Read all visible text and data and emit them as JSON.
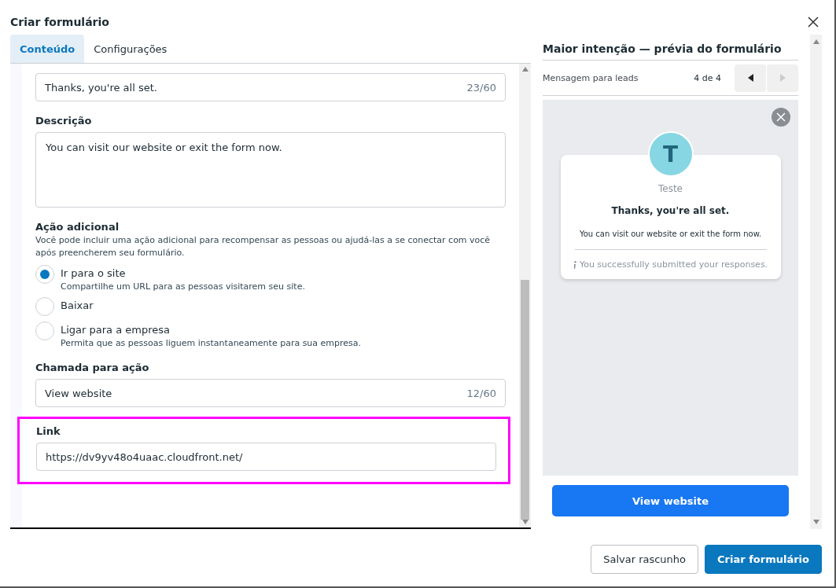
{
  "window": {
    "title": "Criar formulário"
  },
  "tabs": [
    {
      "label": "Conteúdo",
      "selected": true
    },
    {
      "label": "Configurações",
      "selected": false
    }
  ],
  "form": {
    "title_field": {
      "value": "Thanks, you're all set.",
      "counter": "23/60"
    },
    "description": {
      "label": "Descrição",
      "value": "You can visit our website or exit the form now."
    },
    "additional_action": {
      "label": "Ação adicional",
      "help": "Você pode incluir uma ação adicional para recompensar as pessoas ou ajudá-las a se conectar com você após preencherem seu formulário.",
      "options": [
        {
          "label": "Ir para o site",
          "hint": "Compartilhe um URL para as pessoas visitarem seu site.",
          "selected": true
        },
        {
          "label": "Baixar",
          "selected": false
        },
        {
          "label": "Ligar para a empresa",
          "hint": "Permita que as pessoas liguem instantaneamente para sua empresa.",
          "selected": false
        }
      ]
    },
    "cta": {
      "label": "Chamada para ação",
      "value": "View website",
      "counter": "12/60"
    },
    "link": {
      "label": "Link",
      "value": "https://dv9yv48o4uaac.cloudfront.net/",
      "highlighted": true
    }
  },
  "preview": {
    "title": "Maior intenção — prévia do formulário",
    "section": "Mensagem para leads",
    "pager": "4 de 4",
    "card": {
      "avatar": "T",
      "name": "Teste",
      "heading": "Thanks, you're all set.",
      "body": "You can visit our website or exit the form now.",
      "note": "You successfully submitted your responses."
    },
    "button": "View website"
  },
  "footer": {
    "buttons": [
      {
        "label": "Salvar rascunho",
        "kind": "secondary"
      },
      {
        "label": "Criar formulário",
        "kind": "primary"
      }
    ]
  }
}
